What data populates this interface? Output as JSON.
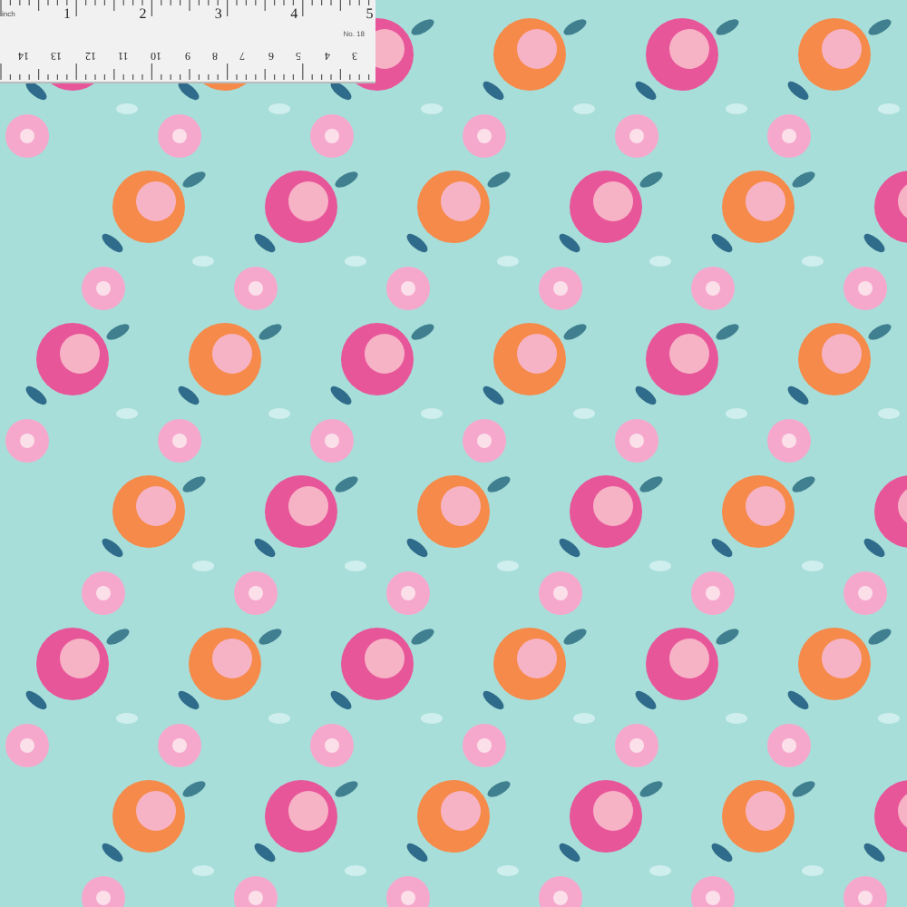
{
  "ruler": {
    "inch_label": "inch",
    "inch_marks": [
      "1",
      "2",
      "3",
      "4",
      "5"
    ],
    "model": "No. 18",
    "cm_marks": [
      "14",
      "13",
      "12",
      "11",
      "10",
      "9",
      "8",
      "7",
      "6",
      "5",
      "4",
      "3"
    ]
  }
}
